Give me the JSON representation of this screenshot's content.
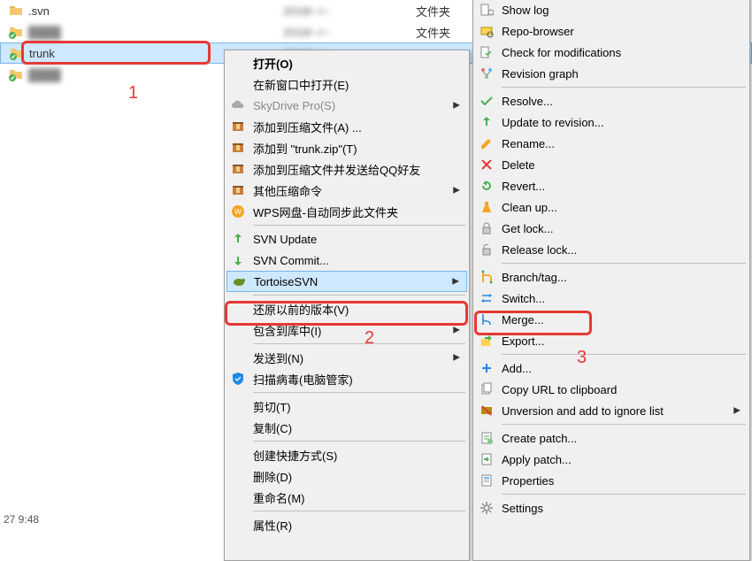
{
  "files": [
    {
      "name": ".svn",
      "type": "文件夹",
      "icon": "folder",
      "blurred": false
    },
    {
      "name": "████",
      "type": "文件夹",
      "icon": "folder-svn",
      "blurred": true
    },
    {
      "name": "trunk",
      "type": "",
      "icon": "folder-svn",
      "blurred": false,
      "selected": true
    },
    {
      "name": "████",
      "type": "",
      "icon": "folder-svn",
      "blurred": true
    }
  ],
  "status_time": "27  9:48",
  "annotations": {
    "a1": "1",
    "a2": "2",
    "a3": "3"
  },
  "menu1": {
    "items": [
      {
        "label": "打开(O)",
        "bold": true
      },
      {
        "label": "在新窗口中打开(E)"
      },
      {
        "label": "SkyDrive Pro(S)",
        "icon": "cloud",
        "disabled": true,
        "submenu": true
      },
      {
        "label": "添加到压缩文件(A) ...",
        "icon": "archive"
      },
      {
        "label": "添加到 \"trunk.zip\"(T)",
        "icon": "archive"
      },
      {
        "label": "添加到压缩文件并发送给QQ好友",
        "icon": "archive"
      },
      {
        "label": "其他压缩命令",
        "icon": "archive",
        "submenu": true
      },
      {
        "label": "WPS网盘-自动同步此文件夹",
        "icon": "wps"
      },
      {
        "sep": true
      },
      {
        "label": "SVN Update",
        "icon": "svn-update"
      },
      {
        "label": "SVN Commit...",
        "icon": "svn-commit"
      },
      {
        "label": "TortoiseSVN",
        "icon": "tortoise",
        "submenu": true,
        "highlighted": true
      },
      {
        "sep": true
      },
      {
        "label": "还原以前的版本(V)"
      },
      {
        "label": "包含到库中(I)",
        "submenu": true
      },
      {
        "sep": true
      },
      {
        "label": "发送到(N)",
        "submenu": true
      },
      {
        "label": "扫描病毒(电脑管家)",
        "icon": "shield-blue"
      },
      {
        "sep": true
      },
      {
        "label": "剪切(T)"
      },
      {
        "label": "复制(C)"
      },
      {
        "sep": true
      },
      {
        "label": "创建快捷方式(S)"
      },
      {
        "label": "删除(D)"
      },
      {
        "label": "重命名(M)"
      },
      {
        "sep": true
      },
      {
        "label": "属性(R)"
      }
    ]
  },
  "menu2": {
    "items": [
      {
        "label": "Show log",
        "icon": "log"
      },
      {
        "label": "Repo-browser",
        "icon": "repo"
      },
      {
        "label": "Check for modifications",
        "icon": "check-mods"
      },
      {
        "label": "Revision graph",
        "icon": "rev-graph"
      },
      {
        "sep": true
      },
      {
        "label": "Resolve...",
        "icon": "resolve"
      },
      {
        "label": "Update to revision...",
        "icon": "update-rev"
      },
      {
        "label": "Rename...",
        "icon": "rename"
      },
      {
        "label": "Delete",
        "icon": "delete"
      },
      {
        "label": "Revert...",
        "icon": "revert"
      },
      {
        "label": "Clean up...",
        "icon": "cleanup"
      },
      {
        "label": "Get lock...",
        "icon": "lock"
      },
      {
        "label": "Release lock...",
        "icon": "unlock"
      },
      {
        "sep": true
      },
      {
        "label": "Branch/tag...",
        "icon": "branch"
      },
      {
        "label": "Switch...",
        "icon": "switch"
      },
      {
        "label": "Merge...",
        "icon": "merge"
      },
      {
        "label": "Export...",
        "icon": "export"
      },
      {
        "sep": true
      },
      {
        "label": "Add...",
        "icon": "add"
      },
      {
        "label": "Copy URL to clipboard",
        "icon": "copy-url"
      },
      {
        "label": "Unversion and add to ignore list",
        "icon": "unversion",
        "submenu": true
      },
      {
        "sep": true
      },
      {
        "label": "Create patch...",
        "icon": "create-patch"
      },
      {
        "label": "Apply patch...",
        "icon": "apply-patch"
      },
      {
        "label": "Properties",
        "icon": "properties"
      },
      {
        "sep": true
      },
      {
        "label": "Settings",
        "icon": "settings"
      }
    ]
  }
}
